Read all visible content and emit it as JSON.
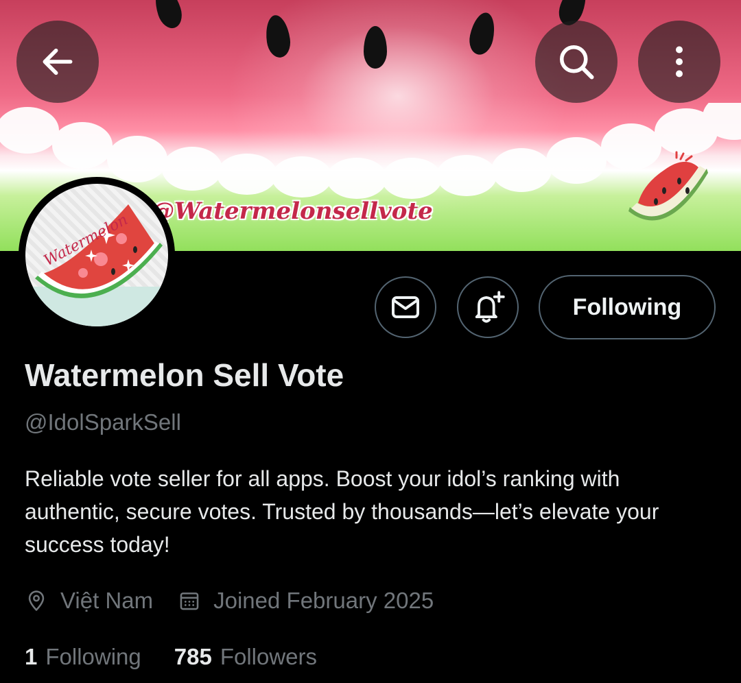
{
  "banner": {
    "handle_text": "@Watermelonsellvote"
  },
  "avatar": {
    "logo_text": "Watermelon"
  },
  "header_icons": {
    "back": "arrow-left-icon",
    "search": "search-icon",
    "more": "more-vertical-icon"
  },
  "actions": {
    "message_icon": "envelope-icon",
    "notify_icon": "bell-plus-icon",
    "follow_label": "Following"
  },
  "profile": {
    "display_name": "Watermelon Sell Vote",
    "handle": "@IdolSparkSell",
    "bio": "Reliable vote seller for all apps. Boost your idol’s ranking with authentic, secure votes. Trusted by thousands—let’s elevate your success today!",
    "location": "Việt Nam",
    "joined": "Joined February 2025"
  },
  "stats": {
    "following_count": "1",
    "following_label": "Following",
    "followers_count": "785",
    "followers_label": "Followers"
  },
  "colors": {
    "background": "#000000",
    "text_primary": "#e7e9ea",
    "text_secondary": "#71767b",
    "border": "#536471",
    "watermelon_red": "#e0453f"
  }
}
